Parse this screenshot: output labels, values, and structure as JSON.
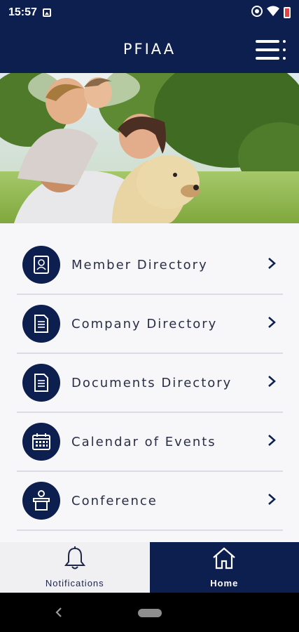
{
  "status_bar": {
    "time": "15:57",
    "icons": [
      "image-notification-icon",
      "hotspot-icon",
      "wifi-icon",
      "battery-low-icon"
    ]
  },
  "header": {
    "title": "PFIAA",
    "menu_icon": "hamburger-menu-icon"
  },
  "hero": {
    "image": "family-with-dog-in-park-photo"
  },
  "menu": {
    "items": [
      {
        "label": "Member Directory",
        "icon": "member-card-icon"
      },
      {
        "label": "Company Directory",
        "icon": "document-icon"
      },
      {
        "label": "Documents Directory",
        "icon": "document-icon"
      },
      {
        "label": "Calendar of Events",
        "icon": "calendar-icon"
      },
      {
        "label": "Conference",
        "icon": "podium-speaker-icon"
      }
    ],
    "chevron_icon": "chevron-right-icon"
  },
  "tabs": [
    {
      "label": "Notifications",
      "icon": "bell-icon",
      "active": false
    },
    {
      "label": "Home",
      "icon": "home-icon",
      "active": true
    }
  ],
  "colors": {
    "primary": "#0d1f4f",
    "background": "#f7f7f9",
    "divider": "#dadde3",
    "text": "#2a2f45"
  }
}
